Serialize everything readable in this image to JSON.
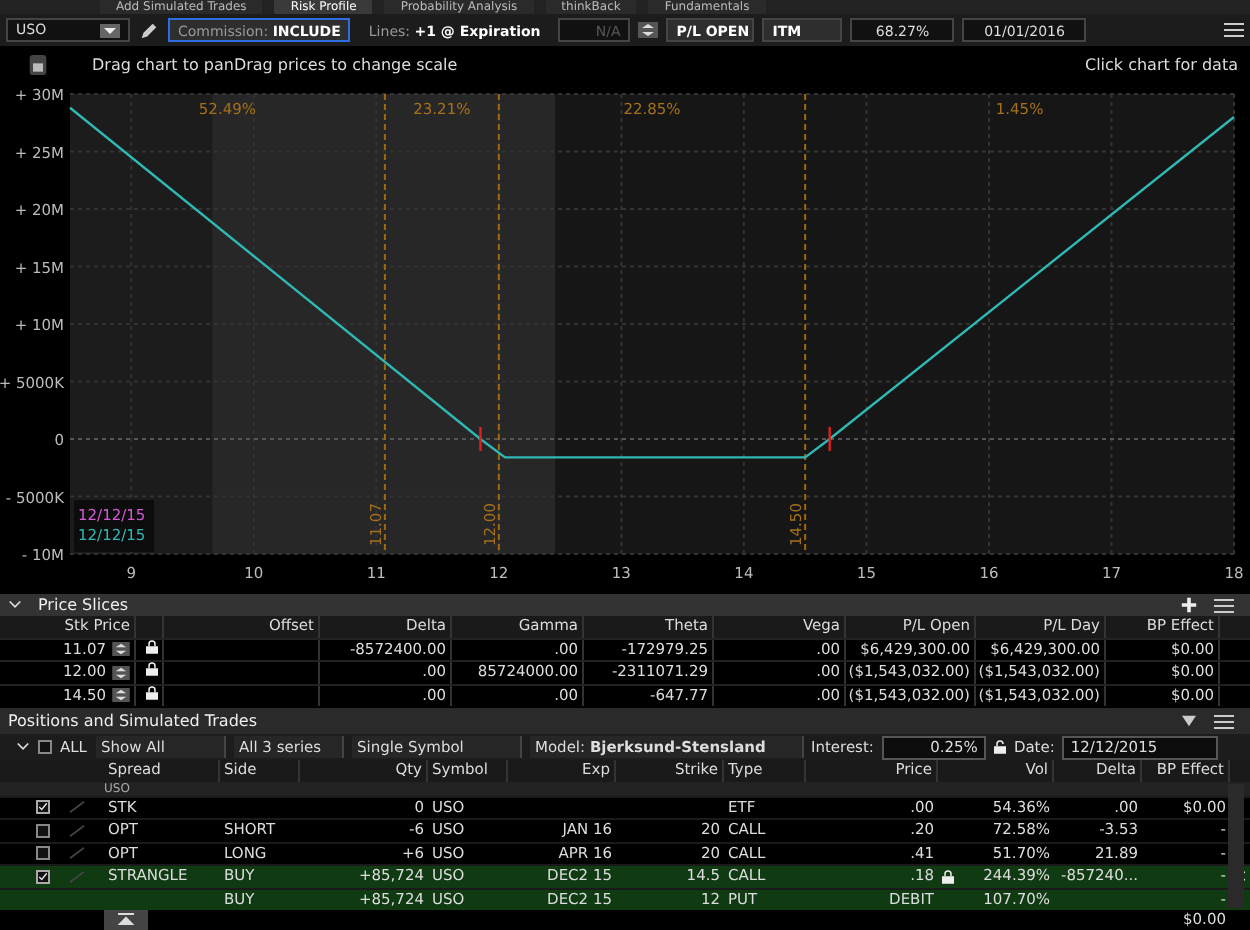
{
  "top_tabs": [
    {
      "label": "Add Simulated Trades",
      "selected": false
    },
    {
      "label": "Risk Profile",
      "selected": true
    },
    {
      "label": "Probability Analysis",
      "selected": false
    },
    {
      "label": "thinkBack",
      "selected": false
    },
    {
      "label": "Fundamentals",
      "selected": false
    }
  ],
  "toolbar": {
    "symbol": "USO",
    "commission_label": "Commission:",
    "commission_value": "INCLUDE",
    "lines_label": "Lines:",
    "lines_value": "+1 @ Expiration",
    "na_field": "N/A",
    "pl_mode": "P/L OPEN",
    "itm": "ITM",
    "percent": "68.27%",
    "date": "01/01/2016"
  },
  "chart_header": {
    "hint": "Drag chart to panDrag prices to change scale",
    "data_hint": "Click chart for data"
  },
  "chart": {
    "zones": [
      "52.49%",
      "23.21%",
      "22.85%",
      "1.45%"
    ],
    "legend": [
      {
        "label": "12/12/15",
        "color": "#d45ad4"
      }
    ],
    "chart_data": {
      "type": "line",
      "x": [
        8.5,
        11.85,
        12.05,
        14.5,
        14.7,
        18
      ],
      "series": [
        {
          "name": "12/12/15",
          "color": "#2fb8b4",
          "values": [
            28800000,
            0,
            -1600000,
            -1600000,
            0,
            28000000
          ]
        }
      ],
      "xlim": [
        8.5,
        18
      ],
      "ylim": [
        -10000000,
        30000000
      ],
      "xticks": [
        9,
        10,
        11,
        12,
        13,
        14,
        15,
        16,
        17,
        18
      ],
      "yticks": [
        {
          "value": 30000000,
          "label": "+ 30M"
        },
        {
          "value": 25000000,
          "label": "+ 25M"
        },
        {
          "value": 20000000,
          "label": "+ 20M"
        },
        {
          "value": 15000000,
          "label": "+ 15M"
        },
        {
          "value": 10000000,
          "label": "+ 10M"
        },
        {
          "value": 5000000,
          "label": "+ 5000K"
        },
        {
          "value": 0,
          "label": "0"
        },
        {
          "value": -5000000,
          "label": "- 5000K"
        },
        {
          "value": -10000000,
          "label": "- 10M"
        }
      ],
      "grid": true,
      "bands": [
        {
          "axis": "x",
          "from": 8.5,
          "to": 9.66,
          "color": "#1c1c1c"
        },
        {
          "axis": "x",
          "from": 9.66,
          "to": 12.46,
          "color": "#272727"
        }
      ],
      "ref_lines": [
        {
          "axis": "y",
          "value": 0,
          "color": "#555555"
        },
        {
          "axis": "x",
          "value": 11.07,
          "label": "11.07",
          "color": "#a0680e"
        },
        {
          "axis": "x",
          "value": 12,
          "label": "12.00",
          "color": "#a0680e"
        },
        {
          "axis": "x",
          "value": 14.5,
          "label": "14.50",
          "color": "#a0680e"
        }
      ]
    }
  },
  "price_slices": {
    "title": "Price Slices",
    "columns": [
      "Stk Price",
      "Offset",
      "Delta",
      "Gamma",
      "Theta",
      "Vega",
      "P/L Open",
      "P/L Day",
      "BP Effect"
    ],
    "rows": [
      {
        "stk_price": "11.07",
        "delta": "-8572400.00",
        "gamma": ".00",
        "theta": "-172979.25",
        "vega": ".00",
        "pl_open": "$6,429,300.00",
        "pl_day": "$6,429,300.00",
        "bp_effect": "$0.00"
      },
      {
        "stk_price": "12.00",
        "delta": ".00",
        "gamma": "85724000.00",
        "theta": "-2311071.29",
        "vega": ".00",
        "pl_open": "($1,543,032.00)",
        "pl_day": "($1,543,032.00)",
        "bp_effect": "$0.00"
      },
      {
        "stk_price": "14.50",
        "delta": ".00",
        "gamma": ".00",
        "theta": "-647.77",
        "vega": ".00",
        "pl_open": "($1,543,032.00)",
        "pl_day": "($1,543,032.00)",
        "bp_effect": "$0.00"
      }
    ]
  },
  "positions": {
    "title": "Positions and Simulated Trades",
    "controls": {
      "all_label": "ALL",
      "all_checked": false,
      "show": "Show All",
      "series": "All 3 series",
      "symbol_mode": "Single Symbol",
      "model_label": "Model:",
      "model": "Bjerksund-Stensland",
      "interest_label": "Interest:",
      "interest": "0.25%",
      "date_label": "Date:",
      "date": "12/12/2015"
    },
    "columns": [
      "Spread",
      "Side",
      "Qty",
      "Symbol",
      "Exp",
      "Strike",
      "Type",
      "Price",
      "Vol",
      "Delta",
      "BP Effect"
    ],
    "group": "USO",
    "rows": [
      {
        "kind": "main",
        "checked": true,
        "simulated": false,
        "spread": "STK",
        "qty": "0",
        "symbol": "USO",
        "type": "ETF",
        "price": ".00",
        "vol": "54.36%",
        "delta": ".00",
        "bp": "$0.00"
      },
      {
        "kind": "main",
        "checked": false,
        "simulated": false,
        "spread": "OPT",
        "side": "SHORT",
        "qty": "-6",
        "symbol": "USO",
        "exp": "JAN 16",
        "strike": "20",
        "type": "CALL",
        "price": ".20",
        "vol": "72.58%",
        "delta": "-3.53",
        "bp": "-"
      },
      {
        "kind": "main",
        "checked": false,
        "simulated": false,
        "spread": "OPT",
        "side": "LONG",
        "qty": "+6",
        "symbol": "USO",
        "exp": "APR 16",
        "strike": "20",
        "type": "CALL",
        "price": ".41",
        "vol": "51.70%",
        "delta": "21.89",
        "bp": "-"
      },
      {
        "kind": "main",
        "checked": true,
        "simulated": true,
        "spread": "STRANGLE",
        "side": "BUY",
        "qty": "+85,724",
        "symbol": "USO",
        "exp": "DEC2 15",
        "strike": "14.5",
        "type": "CALL",
        "price": ".18",
        "vol": "244.39%",
        "delta": "-857240...",
        "bp": "-"
      },
      {
        "kind": "leg",
        "simulated": true,
        "side": "BUY",
        "qty": "+85,724",
        "symbol": "USO",
        "exp": "DEC2 15",
        "strike": "12",
        "type": "PUT",
        "price": "DEBIT",
        "vol": "107.70%",
        "bp": "-"
      }
    ],
    "total_bp": "$0.00"
  }
}
